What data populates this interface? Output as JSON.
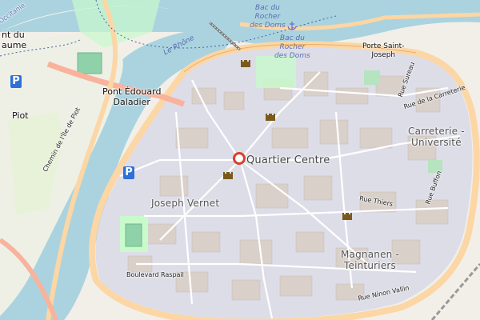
{
  "map": {
    "colors": {
      "water": "#aad3df",
      "land": "#f2efe9",
      "old_town": "#dddde8",
      "major_road": "#f9b29c",
      "ring_road": "#fcd6a4",
      "park": "#c8facc",
      "pin": "#d9402b"
    },
    "labels": {
      "quartier_centre": "Quartier Centre",
      "joseph_vernet": "Joseph Vernet",
      "magnanen_1": "Magnanen -",
      "magnanen_2": "Teinturiers",
      "carreterie_1": "Carreterie -",
      "carreterie_2": "Université",
      "porte_saint_joseph_1": "Porte Saint-",
      "porte_saint_joseph_2": "Joseph",
      "pont_daladier_1": "Pont Édouard",
      "pont_daladier_2": "Daladier",
      "le_rhone": "Le Rhône",
      "bac_rocher_1a": "Bac du",
      "bac_rocher_1b": "Rocher",
      "bac_rocher_1c": "des Doms",
      "bac_rocher_2a": "Bac du",
      "bac_rocher_2b": "Rocher",
      "bac_rocher_2c": "des Doms",
      "piot": "Piot",
      "pont_du_1": "nt du",
      "pont_du_2": "aume",
      "occitanie": "Occitanie",
      "chemin_ile_piot": "Chemin de l'Île de Piot",
      "boulevard_raspail": "Boulevard Raspail",
      "rue_ninon_vallin": "Rue Ninon Vallin",
      "rue_thiers": "Rue Thiers",
      "rue_buffon": "Rue Buffon",
      "rue_carreterie": "Rue de la Carreterie",
      "rue_guirand": "Rue Guirand",
      "rue_sureau": "Rue Sureau"
    },
    "parking_symbol": "P",
    "icons": [
      "location-pin-icon",
      "castle-icon",
      "parking-icon",
      "anchor-icon"
    ]
  }
}
